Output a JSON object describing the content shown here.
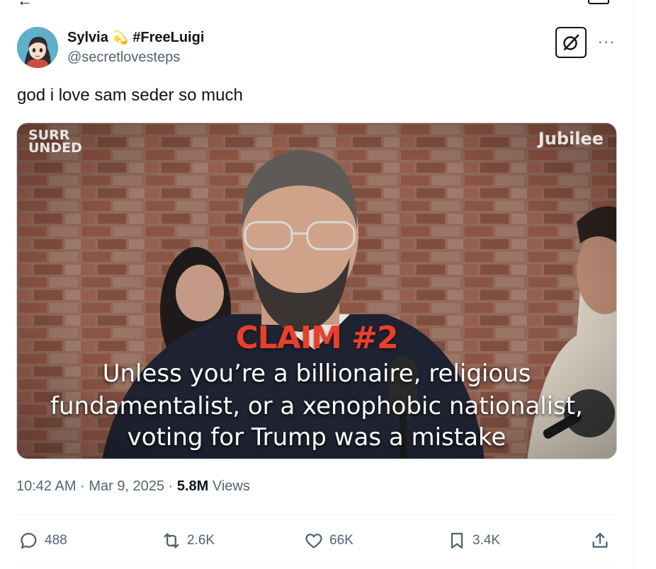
{
  "post": {
    "display_name": "Sylvia",
    "name_emoji": "💫",
    "hashtag_name": "#FreeLuigi",
    "handle": "@secretlovesteps",
    "text": "god i love sam seder so much"
  },
  "media": {
    "brand_left_line1": "SURR",
    "brand_left_line2": "UNDED",
    "brand_right": "Jubilee",
    "claim": "CLAIM #2",
    "caption_line1": "Unless you’re a billionaire, religious",
    "caption_line2": "fundamentalist, or a xenophobic nationalist,",
    "caption_line3": "voting for Trump was a mistake"
  },
  "meta": {
    "time": "10:42 AM",
    "dot1": "·",
    "date": "Mar 9, 2025",
    "dot2": "·",
    "views_count": "5.8M",
    "views_label": "Views"
  },
  "actions": {
    "replies": "488",
    "reposts": "2.6K",
    "likes": "66K",
    "bookmarks": "3.4K"
  },
  "icons": {
    "reply": "reply-icon",
    "repost": "repost-icon",
    "like": "heart-icon",
    "bookmark": "bookmark-icon",
    "share": "share-icon",
    "grok": "grok-icon",
    "more": "more-icon"
  },
  "colors": {
    "text_primary": "#0f1419",
    "text_secondary": "#536471",
    "claim_red": "#e8402a",
    "divider": "#eff3f4"
  }
}
